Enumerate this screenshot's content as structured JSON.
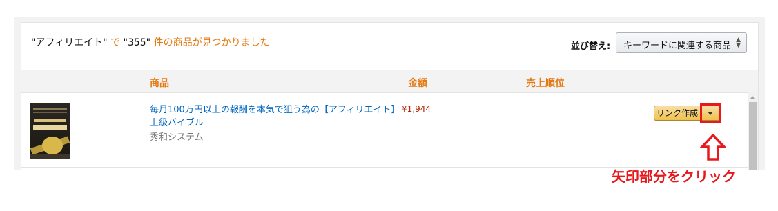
{
  "search": {
    "keyword": "\"アフィリエイト\"",
    "de": " で ",
    "count": "\"355\"",
    "suffix": " 件の商品が見つかりました"
  },
  "sort": {
    "label": "並び替え:",
    "selected": "キーワードに関連する商品"
  },
  "table": {
    "headers": [
      "商品",
      "金額",
      "売上順位"
    ]
  },
  "product": {
    "title": "毎月100万円以上の報酬を本気で狙う為の【アフィリエイト】上級バイブル",
    "publisher": "秀和システム",
    "price": "¥1,944",
    "link_button": "リンク作成"
  },
  "annotation": {
    "text": "矢印部分をクリック"
  },
  "colors": {
    "accent_orange": "#e47911",
    "link_blue": "#0066c0",
    "price_red": "#b12704",
    "highlight_red": "#e8191c"
  }
}
